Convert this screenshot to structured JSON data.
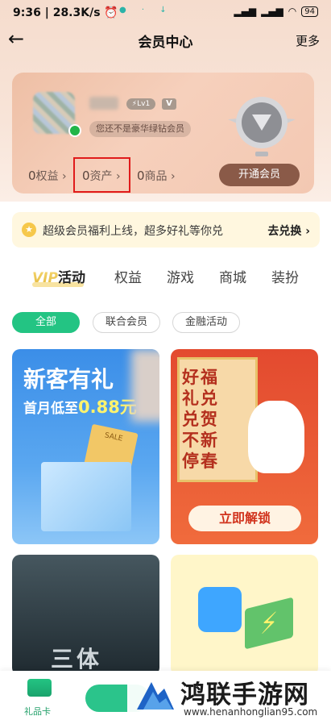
{
  "status_bar": {
    "time": "9:36",
    "net_speed": "28.3K/s",
    "battery": "94"
  },
  "nav": {
    "title": "会员中心",
    "more": "更多"
  },
  "profile": {
    "level_badge": "Lv1",
    "v_badge": "V",
    "member_status": "您还不是豪华绿钻会员"
  },
  "stats": {
    "rights": {
      "value": "0",
      "label": "权益"
    },
    "assets": {
      "value": "0",
      "label": "资产"
    },
    "goods": {
      "value": "0",
      "label": "商品"
    }
  },
  "open_membership": "开通会员",
  "notice": {
    "text": "超级会员福利上线，超多好礼等你兑",
    "action": "去兑换"
  },
  "tabs": [
    {
      "prefix": "VIP",
      "label": "活动"
    },
    {
      "label": "权益"
    },
    {
      "label": "游戏"
    },
    {
      "label": "商城"
    },
    {
      "label": "装扮"
    }
  ],
  "filters": [
    "全部",
    "联合会员",
    "金融活动"
  ],
  "promos": {
    "new_customer": {
      "headline": "新客有礼",
      "sub_prefix": "首月低至",
      "price": "0.88元",
      "ticket": "SALE"
    },
    "spring": {
      "vertical_text": "好福礼兑兑贺不新停春",
      "button": "立即解锁"
    },
    "movie": {
      "title": "三体"
    }
  },
  "bottom": {
    "gift_label": "礼品卡"
  },
  "watermark": {
    "title": "鸿联手游网",
    "url": "www.henanhonglian95.com"
  }
}
